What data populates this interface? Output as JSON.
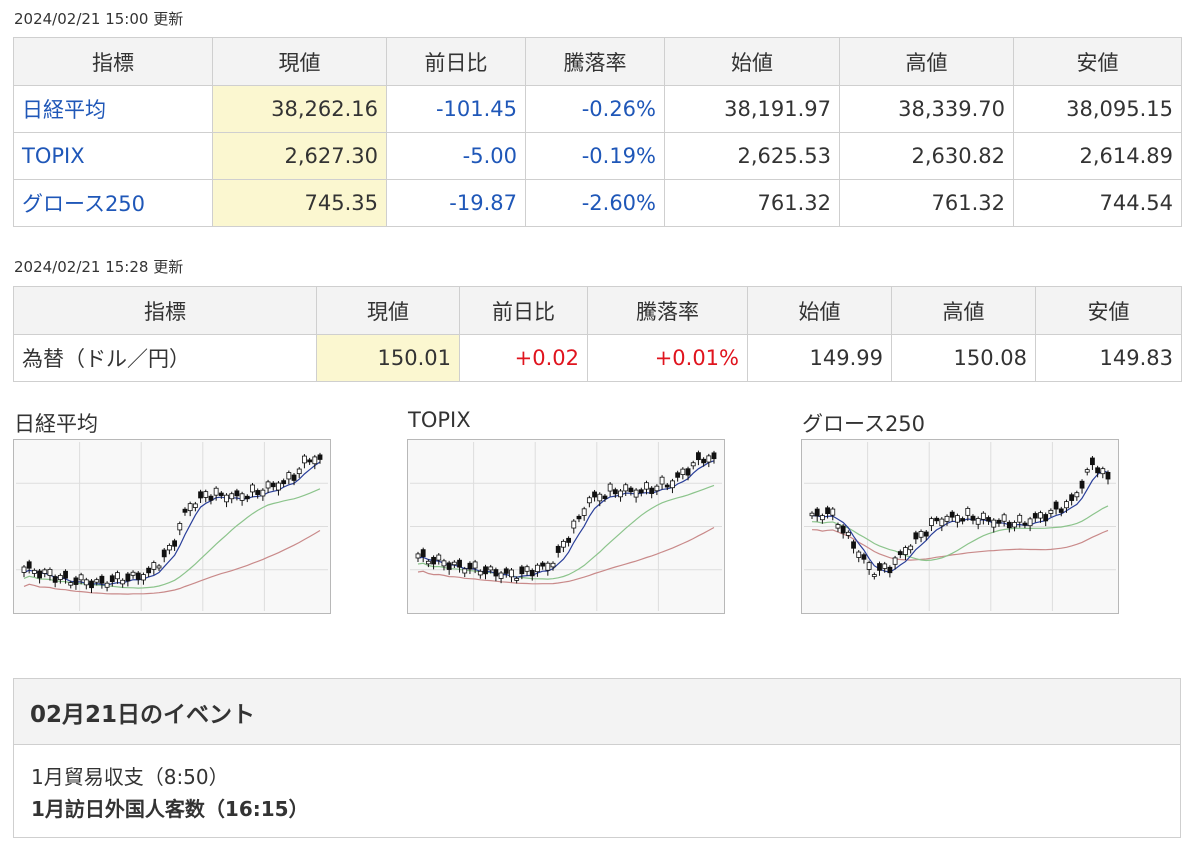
{
  "section1": {
    "updated": "2024/02/21 15:00 更新",
    "headers": [
      "指標",
      "現値",
      "前日比",
      "騰落率",
      "始値",
      "高値",
      "安値"
    ],
    "rows": [
      {
        "name": "日経平均",
        "current": "38,262.16",
        "change": "-101.45",
        "rate": "-0.26%",
        "open": "38,191.97",
        "high": "38,339.70",
        "low": "38,095.15"
      },
      {
        "name": "TOPIX",
        "current": "2,627.30",
        "change": "-5.00",
        "rate": "-0.19%",
        "open": "2,625.53",
        "high": "2,630.82",
        "low": "2,614.89"
      },
      {
        "name": "グロース250",
        "current": "745.35",
        "change": "-19.87",
        "rate": "-2.60%",
        "open": "761.32",
        "high": "761.32",
        "low": "744.54"
      }
    ]
  },
  "section2": {
    "updated": "2024/02/21 15:28 更新",
    "headers": [
      "指標",
      "現値",
      "前日比",
      "騰落率",
      "始値",
      "高値",
      "安値"
    ],
    "rows": [
      {
        "name": "為替（ドル／円）",
        "current": "150.01",
        "change": "+0.02",
        "rate": "+0.01%",
        "open": "149.99",
        "high": "150.08",
        "low": "149.83"
      }
    ]
  },
  "charts": [
    {
      "title": "日経平均"
    },
    {
      "title": "TOPIX"
    },
    {
      "title": "グロース250"
    }
  ],
  "event": {
    "title": "02月21日のイベント",
    "items": [
      "1月貿易収支（8:50）",
      "1月訪日外国人客数（16:15）"
    ]
  },
  "colors": {
    "positive": "#e0141e",
    "negative": "#1f57b8",
    "highlight": "#fbf7d0"
  }
}
